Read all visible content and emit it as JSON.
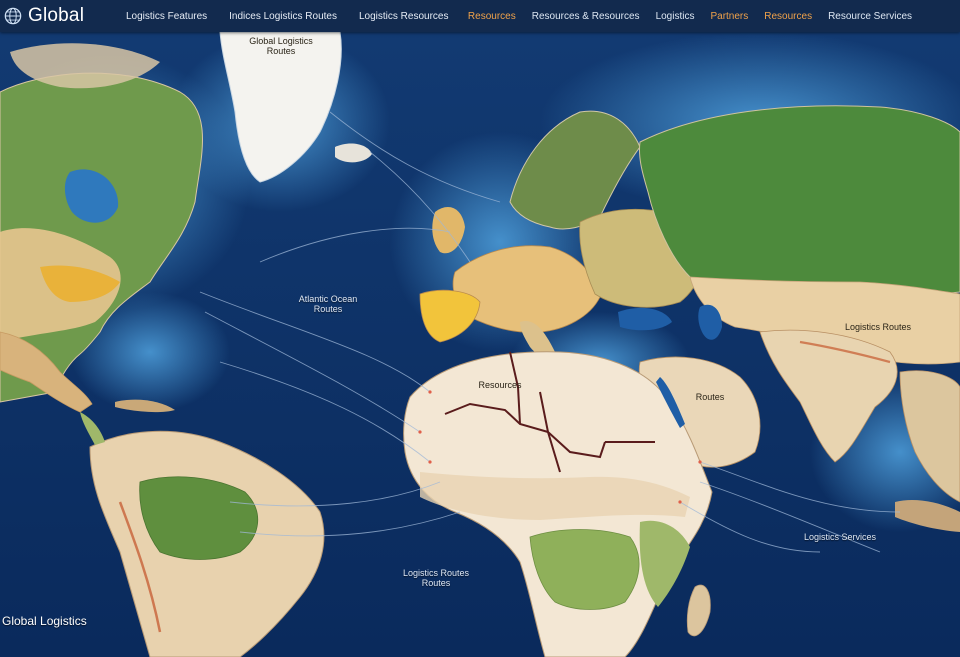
{
  "header": {
    "brand": "Global",
    "brand_icon": "globe-icon",
    "nav_left": [
      "Logistics Features",
      "Indices Logistics Routes",
      "Logistics Resources"
    ],
    "nav_right": [
      {
        "label": "Resources",
        "color": "#f0a24a"
      },
      {
        "label": "Resources & Resources",
        "color": "#dce6f2"
      },
      {
        "label": "Logistics",
        "color": "#dce6f2"
      },
      {
        "label": "Partners",
        "color": "#f0a24a"
      },
      {
        "label": "Resources",
        "color": "#f0a24a"
      },
      {
        "label": "Resource Services",
        "color": "#dce6f2"
      }
    ]
  },
  "map": {
    "labels": {
      "greenland": "Global Logistics Routes",
      "atlantic": "Atlantic Ocean Routes",
      "africa_north": "Resources",
      "arabia": "Routes",
      "india": "Logistics Routes",
      "indian_ocean": "Logistics Services",
      "south_atlantic": "Logistics Routes Routes",
      "bottom_left": "Global Logistics"
    },
    "colors": {
      "ocean_deep": "#0d2f63",
      "ocean_shallow": "#3f8fd0",
      "forest": "#5f8f3e",
      "desert": "#f2e2c6",
      "arid": "#e3c08f",
      "highlight": "#e9b23a",
      "route": "#9fb8d8"
    }
  }
}
